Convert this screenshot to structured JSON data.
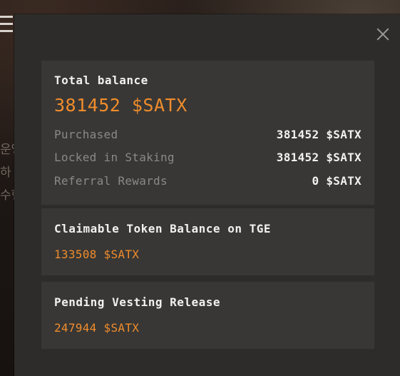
{
  "background": {
    "side_text": [
      "운영",
      "하",
      "수현"
    ]
  },
  "modal": {
    "close_icon": "close-icon"
  },
  "total_balance": {
    "title": "Total balance",
    "value": "381452 $SATX",
    "rows": [
      {
        "label": "Purchased",
        "value": "381452 $SATX"
      },
      {
        "label": "Locked in Staking",
        "value": "381452 $SATX"
      },
      {
        "label": "Referral Rewards",
        "value": "0 $SATX"
      }
    ]
  },
  "claimable": {
    "title": "Claimable Token Balance on TGE",
    "value": "133508 $SATX"
  },
  "pending": {
    "title": "Pending Vesting Release",
    "value": "247944 $SATX"
  },
  "colors": {
    "accent": "#f08c2c",
    "modal_bg": "#2d2c2a",
    "card_bg": "#383735",
    "text_primary": "#f2f1ee",
    "text_muted": "#8a8986"
  }
}
